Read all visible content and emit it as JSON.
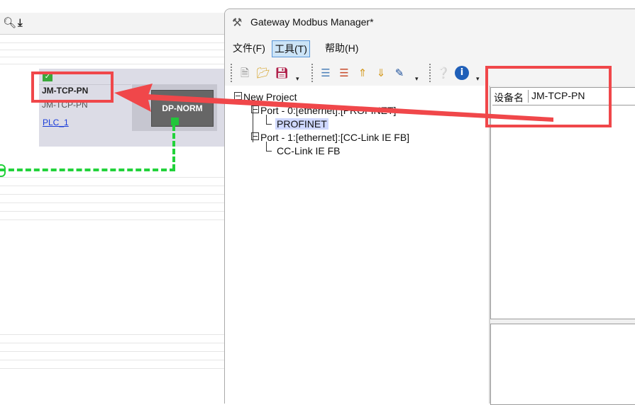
{
  "background_view": {
    "device_title": "JM-TCP-PN",
    "device_subtitle": "JM-TCP-PN",
    "device_link": "PLC_1",
    "module_label": "DP-NORM",
    "toolbar_icons": [
      "zoom-in-icon",
      "download-icon"
    ]
  },
  "window": {
    "title": "Gateway Modbus Manager*",
    "menu": [
      {
        "label": "文件(F)",
        "active": false
      },
      {
        "label": "工具(T)",
        "active": true
      },
      {
        "label": "帮助(H)",
        "active": false
      }
    ],
    "toolbar_icons": [
      "new-file-icon",
      "open-folder-icon",
      "save-icon",
      "tree-add-icon",
      "tree-remove-icon",
      "move-up-icon",
      "move-down-icon",
      "edit-icon",
      "help-doc-icon",
      "info-icon"
    ]
  },
  "tree": {
    "root": "New Project",
    "port0": "Port - 0:[ethernet]:[PROFINET]",
    "port0_child": "PROFINET",
    "port1": "Port - 1:[ethernet]:[CC-Link IE FB]",
    "port1_child": "CC-Link IE FB"
  },
  "properties": {
    "label": "设备名",
    "value": "JM-TCP-PN"
  },
  "annotation": {
    "color": "#f0474a"
  }
}
